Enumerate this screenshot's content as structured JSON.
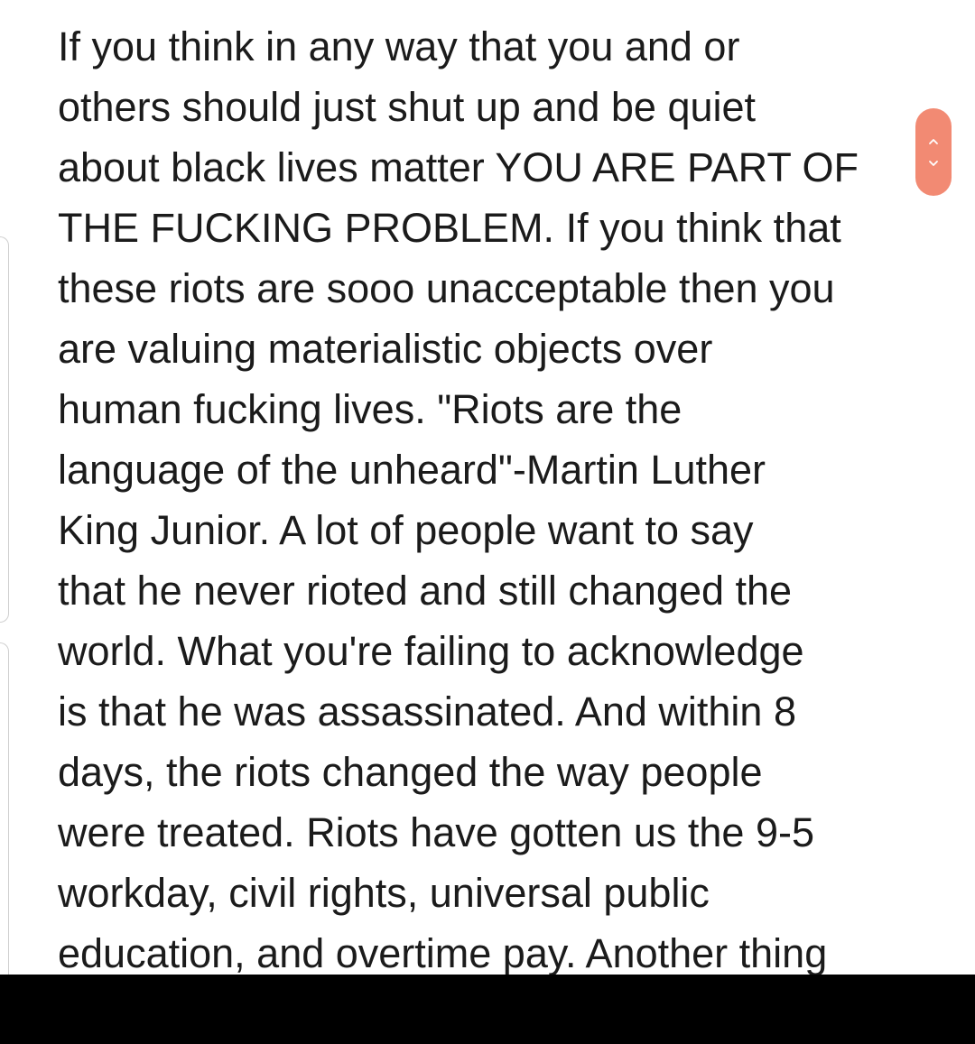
{
  "note": {
    "lines": [
      "If you think in any way that you and or",
      "others should just shut up and be quiet",
      "about black lives matter YOU ARE PART OF",
      "THE FUCKING PROBLEM. If you think that",
      "these riots are sooo unacceptable then you",
      "are valuing materialistic objects over",
      "human fucking lives. \"Riots are the",
      "language of the unheard\"-Martin Luther",
      "King Junior. A lot of people want to say",
      "that he never rioted and still changed the",
      "world. What you're failing to acknowledge",
      "is that he was assassinated. And within 8",
      "days, the riots changed the way people",
      "were treated. Riots have gotten us the 9-5",
      "workday, civil rights, universal public",
      "education, and overtime pay. Another thing"
    ]
  },
  "scroll_control": {
    "up_icon": "chevron-up-icon",
    "down_icon": "chevron-down-icon",
    "color": "#f28a73"
  },
  "colors": {
    "text": "#1b1b1b",
    "background": "#ffffff",
    "nav_bar": "#000000"
  }
}
